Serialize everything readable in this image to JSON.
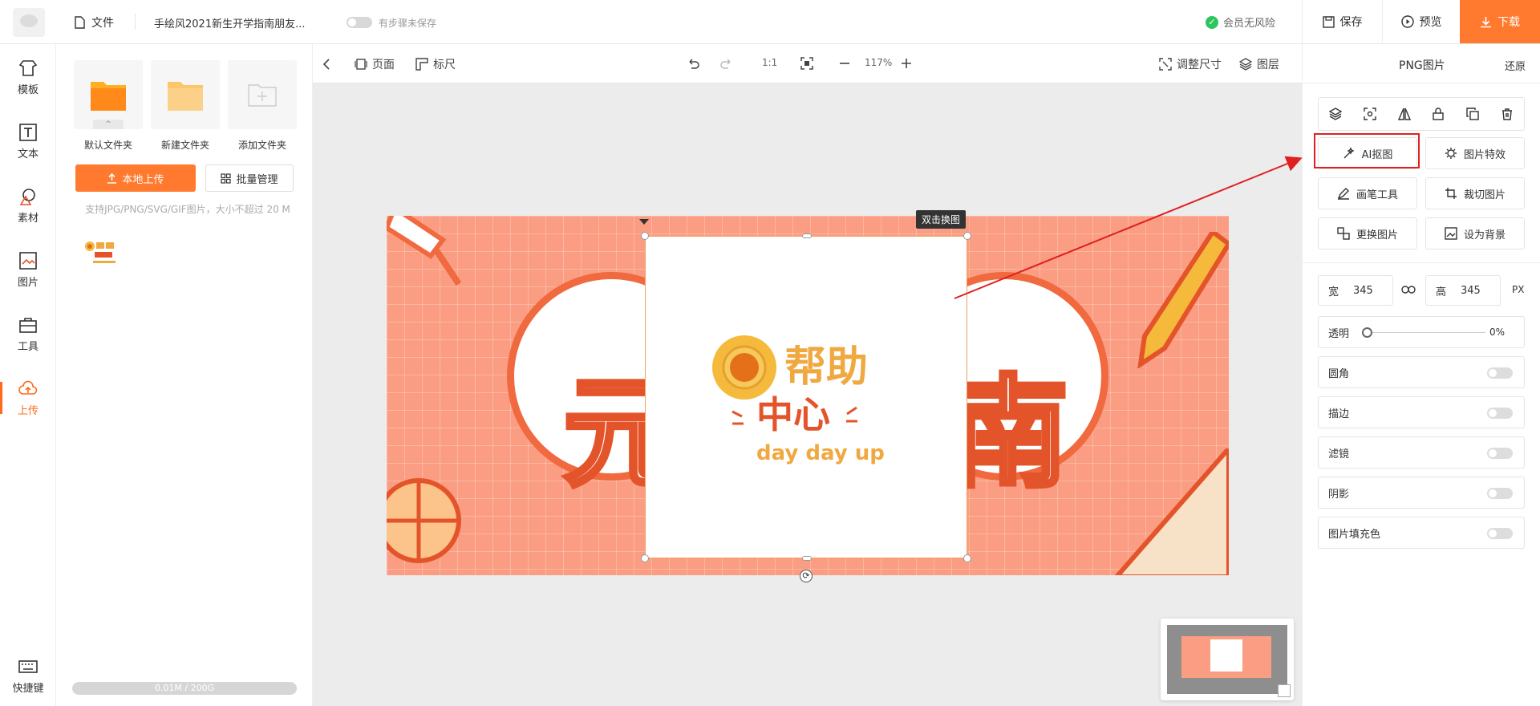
{
  "header": {
    "file_label": "文件",
    "doc_title": "手绘风2021新生开学指南朋友...",
    "autosave_label": "有步骤未保存",
    "member_status": "会员无风险",
    "save_label": "保存",
    "preview_label": "预览",
    "download_label": "下载"
  },
  "sidebar": {
    "items": [
      {
        "label": "模板",
        "icon": "template-icon"
      },
      {
        "label": "文本",
        "icon": "text-icon"
      },
      {
        "label": "素材",
        "icon": "material-icon"
      },
      {
        "label": "图片",
        "icon": "image-icon"
      },
      {
        "label": "工具",
        "icon": "toolbox-icon"
      },
      {
        "label": "上传",
        "icon": "upload-cloud-icon",
        "active": true
      }
    ],
    "shortcut_label": "快捷键"
  },
  "upload_panel": {
    "folders": [
      {
        "label": "默认文件夹"
      },
      {
        "label": "新建文件夹"
      },
      {
        "label": "添加文件夹"
      }
    ],
    "upload_button": "本地上传",
    "batch_button": "批量管理",
    "support_text": "支持JPG/PNG/SVG/GIF图片，大小不超过 20 M",
    "storage_usage": "0.01M / 200G"
  },
  "canvas_toolbar": {
    "page_label": "页面",
    "ruler_label": "标尺",
    "ratio_label": "1:1",
    "zoom_level": "117%",
    "resize_label": "调整尺寸",
    "layers_label": "图层"
  },
  "canvas": {
    "tooltip": "双击换图",
    "logo_title": "帮助",
    "logo_subtitle": "中心",
    "logo_tagline": "day day up"
  },
  "right_panel": {
    "title": "PNG图片",
    "restore_label": "还原",
    "icon_tools": [
      "layers-icon",
      "focus-icon",
      "flip-icon",
      "lock-icon",
      "copy-icon",
      "trash-icon"
    ],
    "actions": [
      {
        "label": "AI抠图",
        "icon": "magic-wand-icon"
      },
      {
        "label": "图片特效",
        "icon": "effects-icon"
      },
      {
        "label": "画笔工具",
        "icon": "pen-icon"
      },
      {
        "label": "裁切图片",
        "icon": "crop-icon"
      },
      {
        "label": "更换图片",
        "icon": "replace-icon"
      },
      {
        "label": "设为背景",
        "icon": "background-icon"
      }
    ],
    "width_label": "宽",
    "width_value": "345",
    "height_label": "高",
    "height_value": "345",
    "unit": "PX",
    "opacity_label": "透明",
    "opacity_value": "0%",
    "toggles": [
      {
        "label": "圆角"
      },
      {
        "label": "描边"
      },
      {
        "label": "滤镜"
      },
      {
        "label": "阴影"
      },
      {
        "label": "图片填充色"
      }
    ]
  },
  "colors": {
    "accent": "#ff7a2e",
    "highlight": "#e02020",
    "success": "#2ec55e",
    "artboard_bg": "#fb9d82"
  }
}
